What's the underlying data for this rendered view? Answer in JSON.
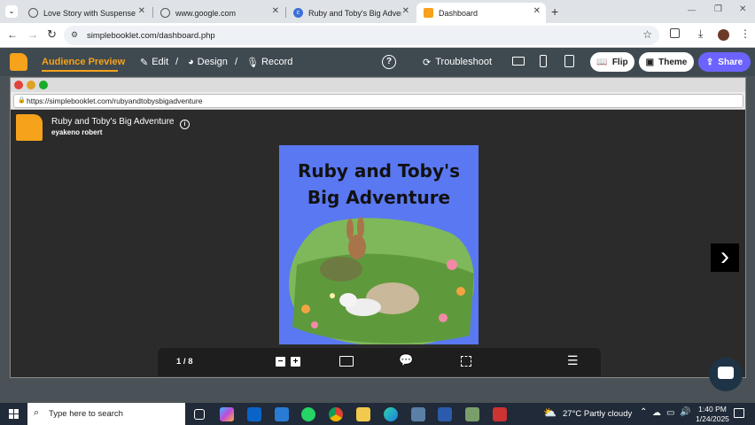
{
  "browser": {
    "tabs": [
      {
        "label": "Love Story with Suspense",
        "active": false
      },
      {
        "label": "www.google.com",
        "active": false
      },
      {
        "label": "Ruby and Toby's Big Adventure",
        "active": false
      },
      {
        "label": "Dashboard",
        "active": true
      }
    ],
    "new_tab": "+",
    "window_controls": {
      "minimize": "—",
      "restore": "❐",
      "close": "✕"
    },
    "url": "simplebooklet.com/dashboard.php"
  },
  "app_header": {
    "audience_preview": "Audience Preview",
    "edit": "Edit",
    "design": "Design",
    "record": "Record",
    "separator": "/",
    "help": "?",
    "troubleshoot": "Troubleshoot",
    "flip": "Flip",
    "theme": "Theme",
    "share": "Share",
    "colors": {
      "accent": "#f6a21a",
      "share": "#6c63ff",
      "header_bg": "#3f4a50"
    }
  },
  "preview": {
    "url": "https://simplebooklet.com/rubyandtobysbigadventure",
    "book_title": "Ruby and Toby's Big Adventure",
    "author": "eyakeno robert",
    "info": "i",
    "cover_title": "Ruby and Toby's Big Adventure",
    "next": "›",
    "page_indicator": "1 / 8",
    "zoom_out": "−",
    "zoom_in": "+"
  },
  "taskbar": {
    "search_placeholder": "Type here to search",
    "weather": "27°C  Partly cloudy",
    "time": "1:40 PM",
    "date": "1/24/2025"
  }
}
